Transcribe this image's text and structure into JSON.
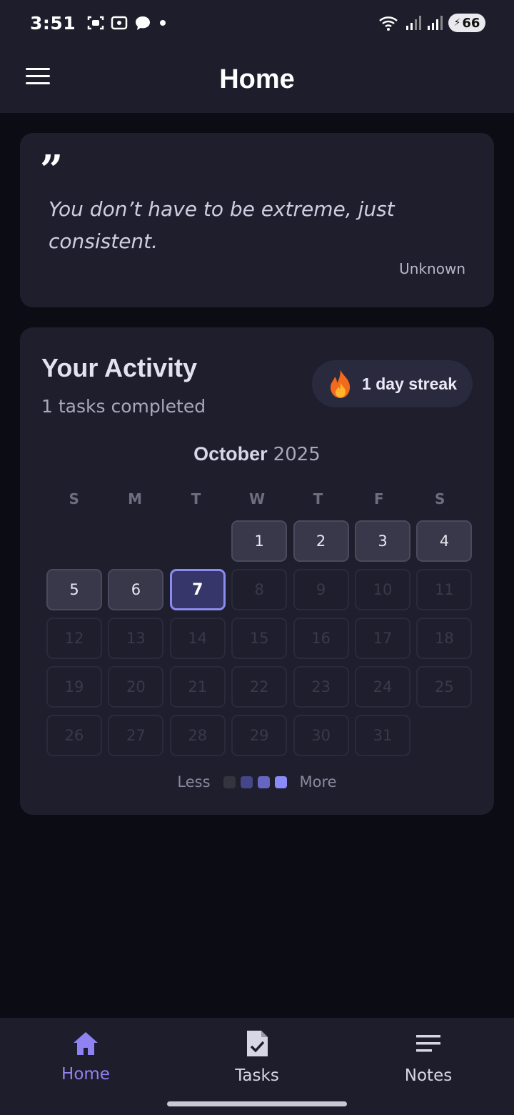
{
  "status": {
    "time": "3:51",
    "battery": "66"
  },
  "header": {
    "title": "Home"
  },
  "quote": {
    "text": "You don’t have to be extreme, just consistent.",
    "author": "Unknown"
  },
  "activity": {
    "title": "Your Activity",
    "subtitle": "1 tasks completed",
    "streak": "1 day streak",
    "month": "October",
    "year": "2025",
    "weekdays": [
      "S",
      "M",
      "T",
      "W",
      "T",
      "F",
      "S"
    ],
    "first_weekday_index": 3,
    "days_in_month": 31,
    "completed_days": [
      1,
      2,
      3,
      4,
      5,
      6
    ],
    "today": 7,
    "legend": {
      "less": "Less",
      "more": "More",
      "colors": [
        "#34343f",
        "#45458a",
        "#6665c0",
        "#8a8af8"
      ]
    }
  },
  "nav": {
    "items": [
      {
        "label": "Home",
        "icon": "home-icon",
        "active": true
      },
      {
        "label": "Tasks",
        "icon": "tasks-icon",
        "active": false
      },
      {
        "label": "Notes",
        "icon": "notes-icon",
        "active": false
      }
    ],
    "accent": "#8f83f4"
  }
}
